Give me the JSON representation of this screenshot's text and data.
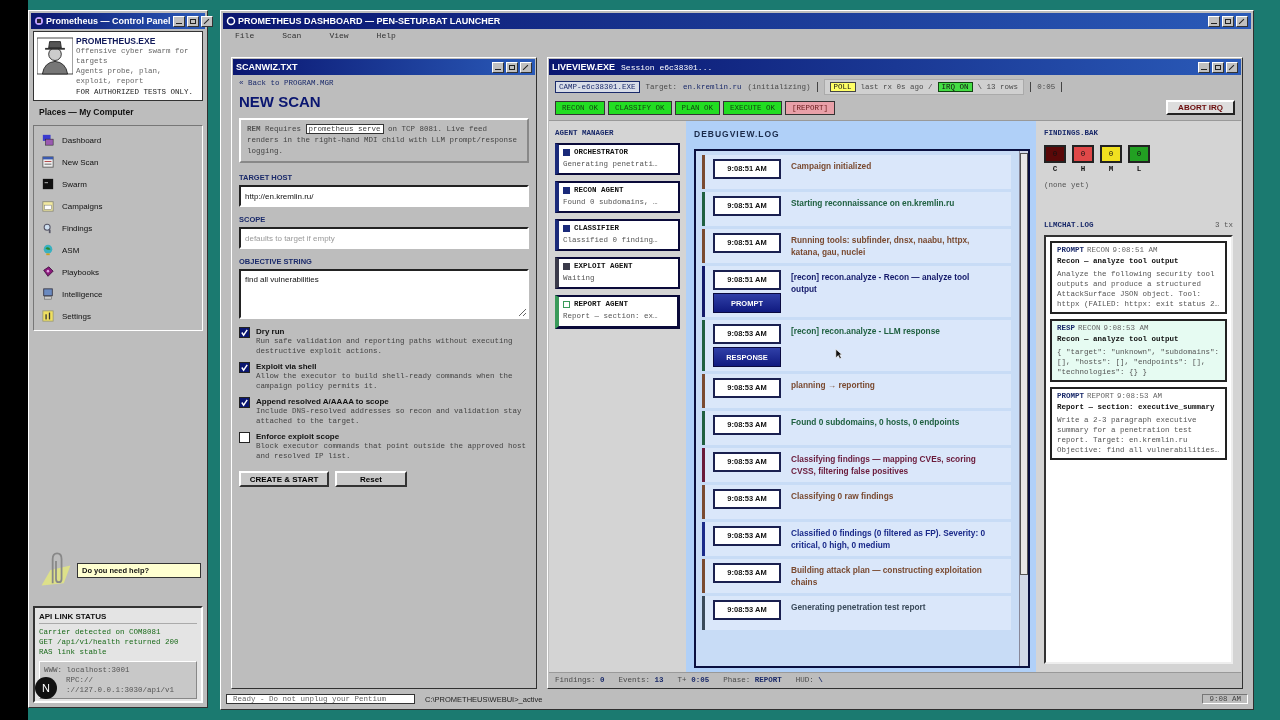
{
  "control_panel": {
    "title": "Prometheus — Control Panel",
    "app_name": "PROMETHEUS.EXE",
    "tagline": "Offensive cyber swarm for targets",
    "tagline_2": "Agents probe, plan, exploit, report",
    "warning": "FOR AUTHORIZED TESTS ONLY.",
    "places_title": "Places — My Computer",
    "nav": [
      {
        "label": "Dashboard"
      },
      {
        "label": "New Scan"
      },
      {
        "label": "Swarm"
      },
      {
        "label": "Campaigns"
      },
      {
        "label": "Findings"
      },
      {
        "label": "ASM"
      },
      {
        "label": "Playbooks"
      },
      {
        "label": "Intelligence"
      },
      {
        "label": "Settings"
      }
    ],
    "help_bubble": "Do you need help?",
    "api_status": {
      "title": "API LINK STATUS",
      "lines": [
        "Carrier detected on COM8081",
        "GET /api/v1/health returned 200",
        "RAS link stable"
      ],
      "endpoints": [
        "WWW: localhost:3001",
        "RPC://",
        "://127.0.0.1:3030/api/v1"
      ]
    },
    "dev_badge": "N"
  },
  "dashboard": {
    "title": "PROMETHEUS DASHBOARD — PEN-SETUP.BAT LAUNCHER",
    "menu": [
      "File",
      "Scan",
      "View",
      "Help"
    ]
  },
  "scan_window": {
    "title": "SCANWIZ.TXT",
    "back_link": "« Back to PROGRAM.MGR",
    "heading": "NEW SCAN",
    "note": {
      "prefix": "REM",
      "before": "Requires",
      "code": "prometheus serve",
      "after": "on TCP 8081. Live feed renders in the right-hand MDI child with LLM prompt/response logging."
    },
    "fields": [
      {
        "label": "TARGET HOST",
        "kind": "input",
        "value": "http://en.kremlin.ru/"
      },
      {
        "label": "SCOPE",
        "kind": "input",
        "placeholder": "defaults to target if empty"
      },
      {
        "label": "OBJECTIVE STRING",
        "kind": "textarea",
        "value": "find all vulnerabilities"
      }
    ],
    "options": [
      {
        "label": "Dry run",
        "description": "Run safe validation and reporting paths without executing destructive exploit actions.",
        "checked": true
      },
      {
        "label": "Exploit via shell",
        "description": "Allow the executor to build shell-ready commands when the campaign policy permits it.",
        "checked": true
      },
      {
        "label": "Append resolved A/AAAA to scope",
        "description": "Include DNS-resolved addresses so recon and validation stay attached to the target.",
        "checked": true
      },
      {
        "label": "Enforce exploit scope",
        "description": "Block executor commands that point outside the approved host and resolved IP list.",
        "checked": false
      }
    ],
    "buttons": [
      "CREATE & START",
      "Reset"
    ]
  },
  "live_view": {
    "title": "LIVEVIEW.EXE",
    "session": "Session e6c38301...",
    "campaign": "CAMP-e6c38301.EXE",
    "target_label": "Target:",
    "target": "en.kremlin.ru",
    "target_state": "(initializing)",
    "poll": {
      "badge": "POLL",
      "text": "last rx 0s ago /",
      "irq": "IRQ ON",
      "rows": "\\ 13 rows"
    },
    "elapsed": "0:05",
    "phases": [
      {
        "label": "RECON OK",
        "current": false
      },
      {
        "label": "CLASSIFY OK",
        "current": false
      },
      {
        "label": "PLAN OK",
        "current": false
      },
      {
        "label": "EXECUTE OK",
        "current": false
      },
      {
        "label": "[REPORT]",
        "current": true
      }
    ],
    "abort_button": "ABORT IRQ",
    "agents_title": "AGENT MANAGER",
    "agents": [
      {
        "name": "ORCHESTRATOR",
        "status": "Generating penetrati…",
        "color": "#1a2a7a",
        "active": false
      },
      {
        "name": "RECON AGENT",
        "status": "Found 0 subdomains, …",
        "color": "#1a2a7a",
        "active": false
      },
      {
        "name": "CLASSIFIER",
        "status": "Classified 0 finding…",
        "color": "#1a2a7a",
        "active": false
      },
      {
        "name": "EXPLOIT AGENT",
        "status": "Waiting",
        "color": "#3a3a4a",
        "active": false
      },
      {
        "name": "REPORT AGENT",
        "status": "Report — section: ex…",
        "color": "#3a9a5a",
        "active": true
      }
    ],
    "log_title": "DEBUGVIEW.LOG",
    "log": [
      {
        "time": "9:08:51 AM",
        "text": "Campaign initialized",
        "color": "#7a4a30"
      },
      {
        "time": "9:08:51 AM",
        "text": "Starting reconnaissance on en.kremlin.ru",
        "color": "#1f6040"
      },
      {
        "time": "9:08:51 AM",
        "text": "Running tools: subfinder, dnsx, naabu, httpx, katana, gau, nuclei",
        "color": "#7a4a30"
      },
      {
        "time": "9:08:51 AM",
        "text": "[recon] recon.analyze - Recon — analyze tool output",
        "color": "#141a6a",
        "action": "PROMPT"
      },
      {
        "time": "9:08:53 AM",
        "text": "[recon] recon.analyze - LLM response",
        "color": "#1f6040",
        "action": "RESPONSE"
      },
      {
        "time": "9:08:53 AM",
        "text": "planning → reporting",
        "color": "#7a4a30"
      },
      {
        "time": "9:08:53 AM",
        "text": "Found 0 subdomains, 0 hosts, 0 endpoints",
        "color": "#1f6040"
      },
      {
        "time": "9:08:53 AM",
        "text": "Classifying findings — mapping CVEs, scoring CVSS, filtering false positives",
        "color": "#6a1a3a"
      },
      {
        "time": "9:08:53 AM",
        "text": "Classifying 0 raw findings",
        "color": "#7a4a30"
      },
      {
        "time": "9:08:53 AM",
        "text": "Classified 0 findings (0 filtered as FP). Severity: 0 critical, 0 high, 0 medium",
        "color": "#1a2a8a"
      },
      {
        "time": "9:08:53 AM",
        "text": "Building attack plan — constructing exploitation chains",
        "color": "#7a4a30"
      },
      {
        "time": "9:08:53 AM",
        "text": "Generating penetration test report",
        "color": "#3a4a5a"
      }
    ],
    "findings_title": "FINDINGS.BAK",
    "severities": [
      {
        "count": "0",
        "letter": "C",
        "color": "#5a0808"
      },
      {
        "count": "0",
        "letter": "H",
        "color": "#e04848"
      },
      {
        "count": "0",
        "letter": "M",
        "color": "#f0e020"
      },
      {
        "count": "0",
        "letter": "L",
        "color": "#22a022"
      }
    ],
    "findings_empty": "(none yet)",
    "chat_title": "LLMCHAT.LOG",
    "chat_count": "3 tx",
    "chat": [
      {
        "kind": "prompt",
        "tag": "PROMPT",
        "agent": "RECON",
        "time": "9:08:51 AM",
        "title": "Recon — analyze tool output",
        "body": "Analyze the following security tool outputs and produce a structured AttackSurface JSON object. Tool: httpx (FAILED: httpx: exit status 2…"
      },
      {
        "kind": "response",
        "tag": "RESP",
        "agent": "RECON",
        "time": "9:08:53 AM",
        "title": "Recon — analyze tool output",
        "body": "{ \"target\": \"unknown\", \"subdomains\": [], \"hosts\": [], \"endpoints\": [], \"technologies\": {} }"
      },
      {
        "kind": "prompt",
        "tag": "PROMPT",
        "agent": "REPORT",
        "time": "9:08:53 AM",
        "title": "Report — section: executive_summary",
        "body": "Write a 2-3 paragraph executive summary for a penetration test report. Target: en.kremlin.ru Objective: find all vulnerabilities…"
      }
    ],
    "stats": [
      {
        "label": "Findings:",
        "value": "0"
      },
      {
        "label": "Events:",
        "value": "13"
      },
      {
        "label": "T+",
        "value": "0:05"
      },
      {
        "label": "Phase:",
        "value": "REPORT"
      },
      {
        "label": "HUD:",
        "value": "\\"
      }
    ]
  },
  "status_bar": {
    "message": "Ready - Do not unplug your Pentium",
    "path": "C:\\PROMETHEUS\\WEBUI>_active",
    "clock": "9:08 AM"
  }
}
